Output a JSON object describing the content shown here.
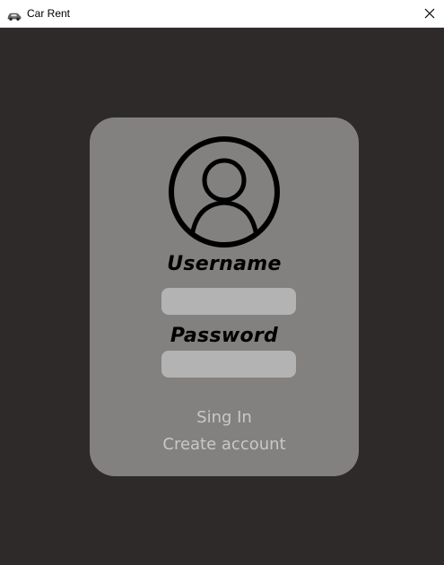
{
  "window": {
    "title": "Car Rent",
    "icon": "car-icon",
    "close_icon": "close-icon"
  },
  "login": {
    "avatar_icon": "user-avatar-icon",
    "username_label": "Username",
    "username_value": "",
    "password_label": "Password",
    "password_value": "",
    "signin_label": "Sing In",
    "create_account_label": "Create account"
  },
  "colors": {
    "background": "#2e2a2a",
    "card": "#828180",
    "field": "#b4b3b3",
    "link_text": "#c9c8c8",
    "titlebar": "#ffffff"
  }
}
